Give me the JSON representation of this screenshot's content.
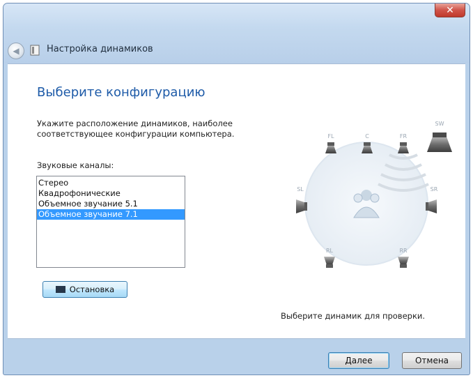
{
  "window": {
    "title": "Настройка динамиков",
    "close_glyph": "✕"
  },
  "page": {
    "heading": "Выберите конфигурацию",
    "instruction": "Укажите расположение динамиков, наиболее соответствующее конфигурации компьютера.",
    "channels_label": "Звуковые каналы:",
    "channels": [
      "Стерео",
      "Квадрофонические",
      "Объемное звучание 5.1",
      "Объемное звучание 7.1"
    ],
    "selected_channel": "Объемное звучание 7.1",
    "stop_label": "Остановка",
    "status_text": "Выберите динамик для проверки."
  },
  "speakers": [
    {
      "id": "front-left",
      "label": "FL"
    },
    {
      "id": "center",
      "label": "C"
    },
    {
      "id": "front-right",
      "label": "FR"
    },
    {
      "id": "subwoofer",
      "label": "SW"
    },
    {
      "id": "side-left",
      "label": "SL"
    },
    {
      "id": "side-right",
      "label": "SR"
    },
    {
      "id": "rear-left",
      "label": "RL"
    },
    {
      "id": "rear-right",
      "label": "RR"
    }
  ],
  "footer": {
    "next_label": "Далее",
    "cancel_label": "Отмена"
  },
  "colors": {
    "heading": "#1e5ba8",
    "selection": "#3399ff",
    "titlebar": "#c4d9ef"
  }
}
